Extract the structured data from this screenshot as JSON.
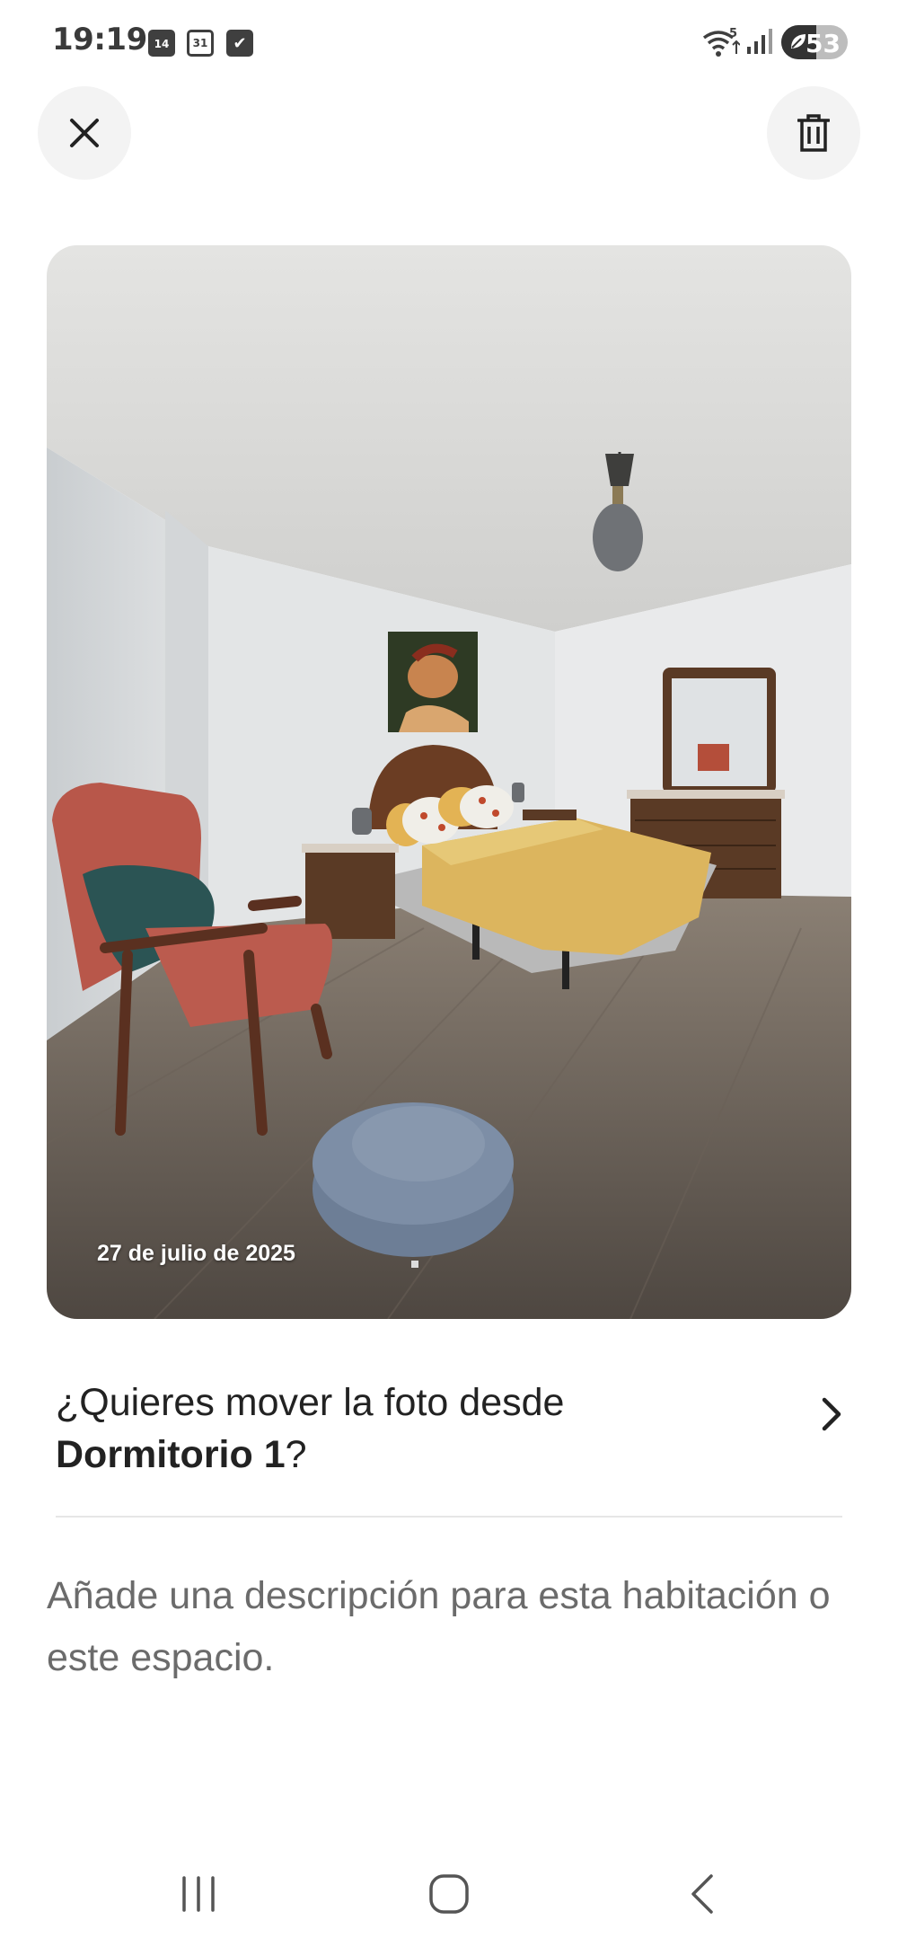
{
  "status_bar": {
    "time": "19:19",
    "notif_icons": [
      {
        "icon": "calendar-14-icon",
        "label": "14"
      },
      {
        "icon": "calendar-31-icon",
        "label": "31"
      },
      {
        "icon": "checkbox-icon",
        "label": "✔"
      }
    ],
    "wifi_label": "5",
    "battery_level": "53"
  },
  "header": {
    "close_icon": "close-icon",
    "delete_icon": "trash-icon"
  },
  "photo": {
    "date": "27 de julio de 2025"
  },
  "move": {
    "question_prefix": "¿Quieres mover la foto desde ",
    "room": "Dormitorio 1",
    "question_suffix": "?",
    "chevron_icon": "chevron-right-icon"
  },
  "description": {
    "placeholder": "Añade una descripción para esta habitación o este espacio."
  },
  "nav_bar": {
    "recents_icon": "recents-icon",
    "home_icon": "home-icon",
    "back_icon": "back-icon"
  }
}
